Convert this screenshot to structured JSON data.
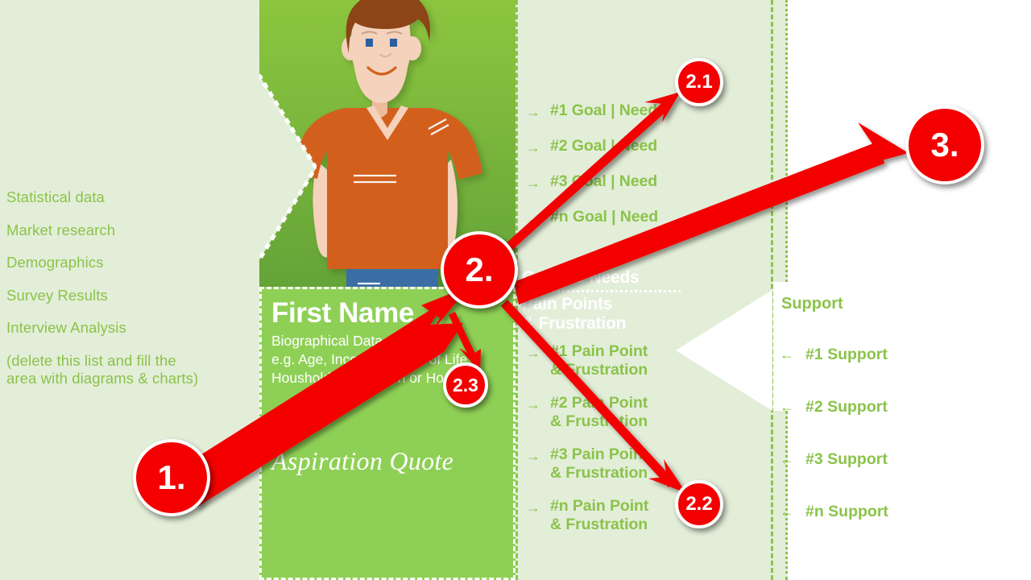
{
  "left_panel": {
    "items": [
      {
        "label": "Statistical data"
      },
      {
        "label": "Market research"
      },
      {
        "label": "Demographics"
      },
      {
        "label": "Survey Results"
      },
      {
        "label": "Interview Analysis"
      },
      {
        "label": "(delete this list and fill the\narea with diagrams & charts)"
      }
    ]
  },
  "persona": {
    "name": "First Name",
    "bio": "Biographical Data\ne.g. Age, Income, Phase of Life,\nHoushold, Profession or Ho",
    "quote_mark": "”",
    "quote": "Aspiration Quote",
    "avatar_icon": "person-illustration"
  },
  "goals": {
    "heading": "Goals & Needs",
    "arrow": "→",
    "items": [
      {
        "label": "#1 Goal | Need"
      },
      {
        "label": "#2 Goal | Need"
      },
      {
        "label": "#3 Goal | Need"
      },
      {
        "label": "#n Goal | Need"
      }
    ]
  },
  "pains": {
    "heading": "Pain Points\n& Frustration",
    "arrow": "→",
    "items": [
      {
        "label": "#1 Pain Point\n& Frustration"
      },
      {
        "label": "#2  Pain Point\n& Frustration"
      },
      {
        "label": "#3 Pain Point\n& Frustration"
      },
      {
        "label": "#n Pain Point\n& Frustration"
      }
    ]
  },
  "support": {
    "heading": "Support",
    "arrow": "←",
    "items": [
      {
        "label": "#1 Support"
      },
      {
        "label": "#2  Support"
      },
      {
        "label": "#3  Support"
      },
      {
        "label": "#n  Support"
      }
    ]
  },
  "annotations": {
    "badges": [
      {
        "label": "1."
      },
      {
        "label": "2."
      },
      {
        "label": "2.1"
      },
      {
        "label": "2.2"
      },
      {
        "label": "2.3"
      },
      {
        "label": "3."
      }
    ]
  },
  "colors": {
    "background_light": "#e3eed9",
    "card_green": "#8ed055",
    "photo_green_top": "#8cc63f",
    "photo_green_bottom": "#64a338",
    "text_green": "#8bc34a",
    "annotation_red": "#f40000",
    "white": "#ffffff",
    "shirt_orange": "#d2601a",
    "hair_brown": "#8b4513",
    "skin": "#f5d2bc",
    "jeans_blue": "#3a6ea5"
  }
}
